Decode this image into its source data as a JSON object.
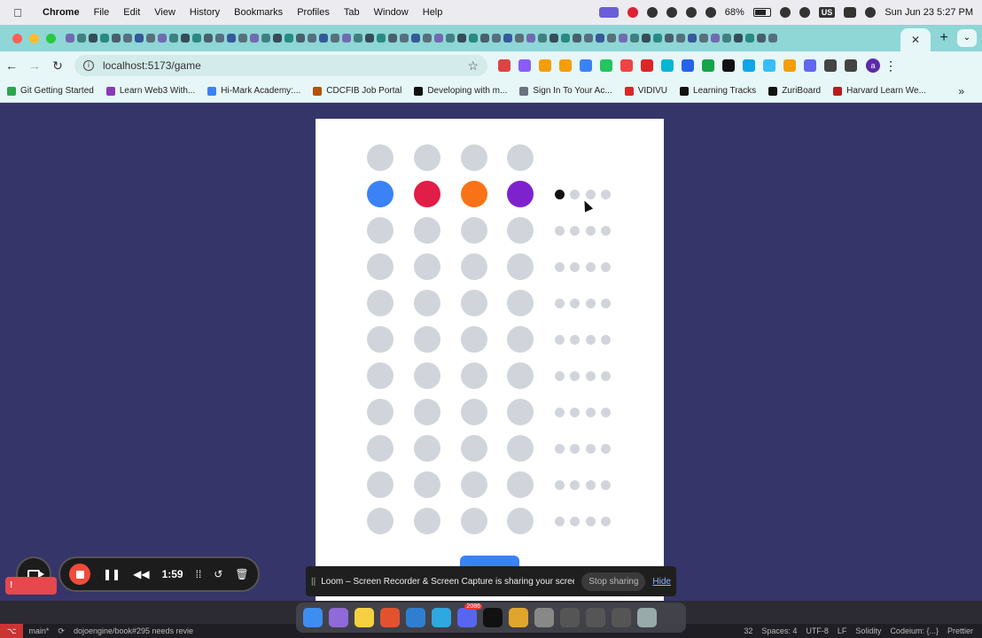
{
  "menubar": {
    "app": "Chrome",
    "items": [
      "File",
      "Edit",
      "View",
      "History",
      "Bookmarks",
      "Profiles",
      "Tab",
      "Window",
      "Help"
    ],
    "battery": "68%",
    "input_source": "US",
    "datetime": "Sun Jun 23  5:27 PM"
  },
  "browser": {
    "url": "localhost:5173/game",
    "avatar_letter": "a",
    "bookmarks": [
      {
        "label": "Git Getting Started",
        "color": "#2da44e"
      },
      {
        "label": "Learn Web3 With...",
        "color": "#8a3ab9"
      },
      {
        "label": "Hi-Mark Academy:...",
        "color": "#3b82f6"
      },
      {
        "label": "CDCFIB Job Portal",
        "color": "#b45309"
      },
      {
        "label": "Developing with m...",
        "color": "#111111"
      },
      {
        "label": "Sign In To Your Ac...",
        "color": "#6b7280"
      },
      {
        "label": "VIDIVU",
        "color": "#dc2626"
      },
      {
        "label": "Learning Tracks",
        "color": "#111111"
      },
      {
        "label": "ZuriBoard",
        "color": "#111111"
      },
      {
        "label": "Harvard Learn We...",
        "color": "#b91c1c"
      }
    ]
  },
  "game": {
    "peg_empty_color": "#d1d5db",
    "guesses": [
      {
        "pegs": [
          "#d1d5db",
          "#d1d5db",
          "#d1d5db",
          "#d1d5db"
        ],
        "hints": []
      },
      {
        "pegs": [
          "#3b82f6",
          "#e11d48",
          "#f97316",
          "#7e22ce"
        ],
        "hints": [
          "#111111",
          "#d1d5db",
          "#d1d5db",
          "#d1d5db"
        ]
      },
      {
        "pegs": [
          "#d1d5db",
          "#d1d5db",
          "#d1d5db",
          "#d1d5db"
        ],
        "hints": [
          "#d1d5db",
          "#d1d5db",
          "#d1d5db",
          "#d1d5db"
        ]
      },
      {
        "pegs": [
          "#d1d5db",
          "#d1d5db",
          "#d1d5db",
          "#d1d5db"
        ],
        "hints": [
          "#d1d5db",
          "#d1d5db",
          "#d1d5db",
          "#d1d5db"
        ]
      },
      {
        "pegs": [
          "#d1d5db",
          "#d1d5db",
          "#d1d5db",
          "#d1d5db"
        ],
        "hints": [
          "#d1d5db",
          "#d1d5db",
          "#d1d5db",
          "#d1d5db"
        ]
      },
      {
        "pegs": [
          "#d1d5db",
          "#d1d5db",
          "#d1d5db",
          "#d1d5db"
        ],
        "hints": [
          "#d1d5db",
          "#d1d5db",
          "#d1d5db",
          "#d1d5db"
        ]
      },
      {
        "pegs": [
          "#d1d5db",
          "#d1d5db",
          "#d1d5db",
          "#d1d5db"
        ],
        "hints": [
          "#d1d5db",
          "#d1d5db",
          "#d1d5db",
          "#d1d5db"
        ]
      },
      {
        "pegs": [
          "#d1d5db",
          "#d1d5db",
          "#d1d5db",
          "#d1d5db"
        ],
        "hints": [
          "#d1d5db",
          "#d1d5db",
          "#d1d5db",
          "#d1d5db"
        ]
      },
      {
        "pegs": [
          "#d1d5db",
          "#d1d5db",
          "#d1d5db",
          "#d1d5db"
        ],
        "hints": [
          "#d1d5db",
          "#d1d5db",
          "#d1d5db",
          "#d1d5db"
        ]
      },
      {
        "pegs": [
          "#d1d5db",
          "#d1d5db",
          "#d1d5db",
          "#d1d5db"
        ],
        "hints": [
          "#d1d5db",
          "#d1d5db",
          "#d1d5db",
          "#d1d5db"
        ]
      },
      {
        "pegs": [
          "#d1d5db",
          "#d1d5db",
          "#d1d5db",
          "#d1d5db"
        ],
        "hints": [
          "#d1d5db",
          "#d1d5db",
          "#d1d5db",
          "#d1d5db"
        ]
      }
    ],
    "submit_color": "#3b82f6"
  },
  "loom": {
    "banner_message": "Loom – Screen Recorder & Screen Capture is sharing your screen.",
    "stop_sharing": "Stop sharing",
    "hide": "Hide",
    "timer": "1:59"
  },
  "statusbar": {
    "branch": "main*",
    "issue": "dojoengine/book#295 needs revie",
    "line_col": "32",
    "spaces": "Spaces: 4",
    "encoding": "UTF-8",
    "eol": "LF",
    "solidity": "Solidity",
    "codeium": "Codeium: {...}",
    "prettier": "Prettier"
  },
  "dock": {
    "badge": "2086"
  }
}
